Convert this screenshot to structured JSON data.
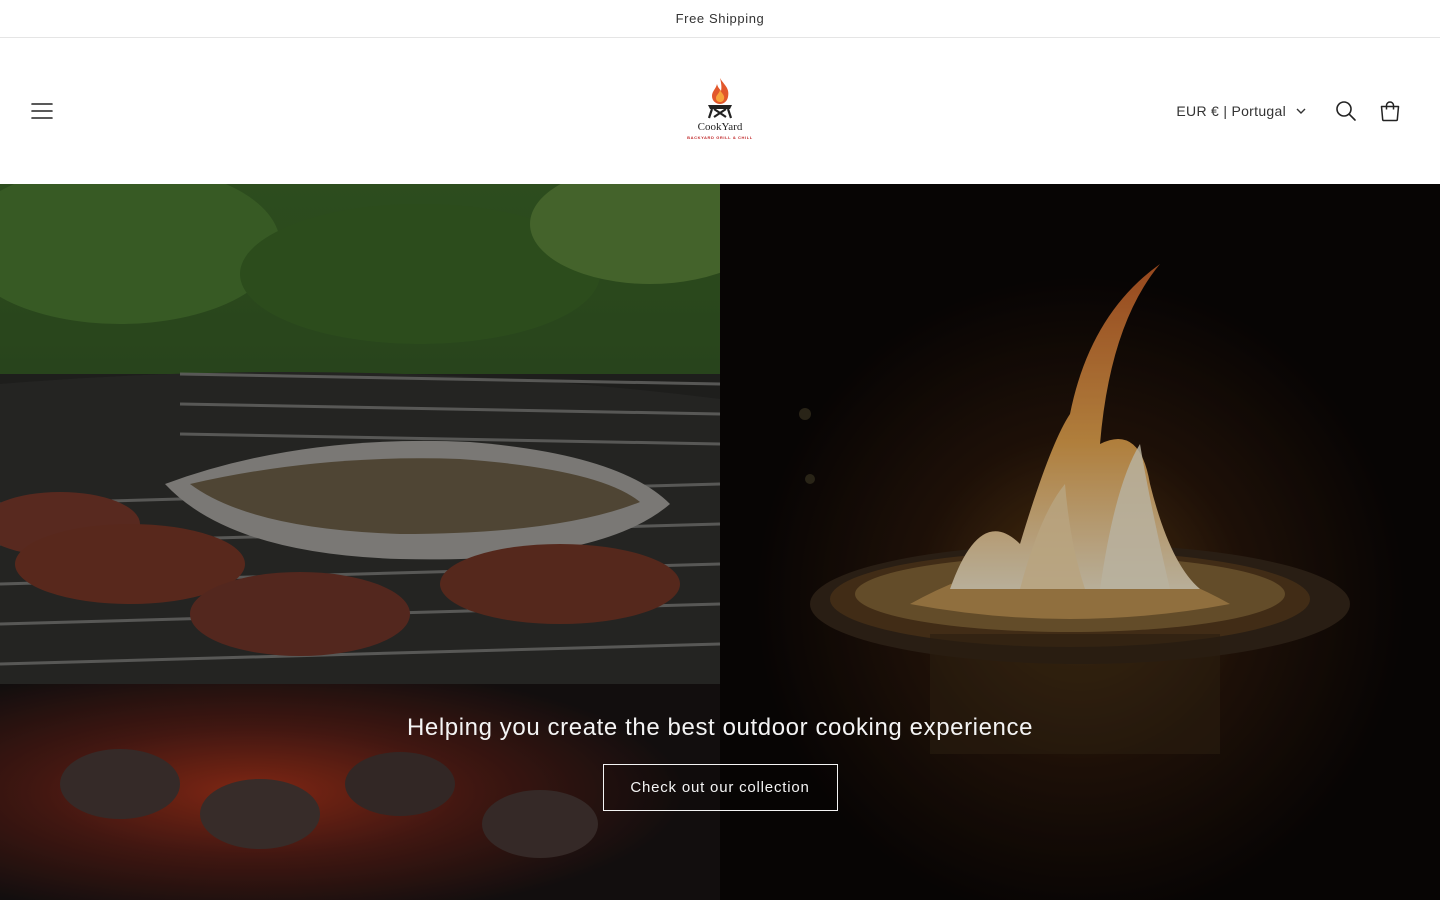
{
  "announcement": {
    "text": "Free Shipping"
  },
  "header": {
    "logo_name": "CookYard",
    "logo_tagline": "BACKYARD GRILL & CHILL",
    "currency": "EUR € | Portugal",
    "icons": [
      "menu-icon",
      "search-icon",
      "cart-icon",
      "chevron-down-icon"
    ]
  },
  "hero": {
    "heading": "Helping you create the best outdoor cooking experience",
    "button_label": "Check out our collection",
    "left_image": "grill-with-burgers-image",
    "right_image": "fire-pit-flame-image"
  },
  "colors": {
    "brand_red": "#c0282a",
    "flame_orange": "#f07a2a",
    "text": "#121212"
  }
}
